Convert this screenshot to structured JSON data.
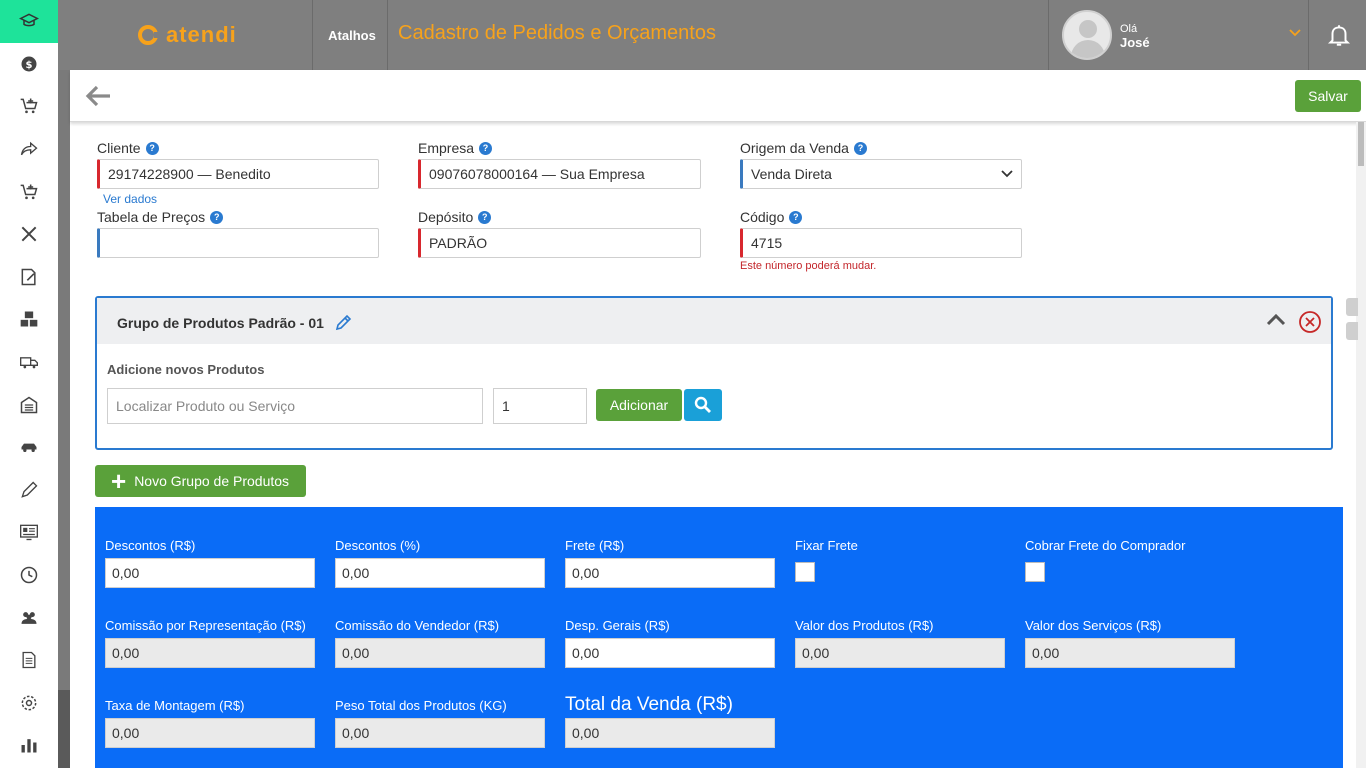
{
  "header": {
    "logo_text": "atendi",
    "shortcuts_label": "Atalhos",
    "page_title": "Cadastro de Pedidos e Orçamentos",
    "user_greeting": "Olá",
    "user_name": "José"
  },
  "toolbar": {
    "save_label": "Salvar"
  },
  "sidebar": {
    "icons": [
      "graduation-cap-icon",
      "dollar-icon",
      "cart-add-icon",
      "share-icon",
      "cart-icon",
      "tools-icon",
      "edit-note-icon",
      "boxes-icon",
      "truck-icon",
      "warehouse-icon",
      "car-icon",
      "pencil-icon",
      "id-card-icon",
      "clock-icon",
      "users-icon",
      "report-icon",
      "gear-icon",
      "bar-chart-icon"
    ],
    "active_color": "#1ee39a"
  },
  "form": {
    "cliente": {
      "label": "Cliente",
      "value": "29174228900 — Benedito",
      "link": "Ver dados"
    },
    "empresa": {
      "label": "Empresa",
      "value": "09076078000164 — Sua Empresa"
    },
    "origem": {
      "label": "Origem da Venda",
      "value": "Venda Direta"
    },
    "tabela": {
      "label": "Tabela de Preços",
      "value": ""
    },
    "deposito": {
      "label": "Depósito",
      "value": "PADRÃO"
    },
    "codigo": {
      "label": "Código",
      "value": "4715",
      "warning": "Este número poderá mudar."
    }
  },
  "group": {
    "title": "Grupo de Produtos Padrão - 01",
    "subtitle": "Adicione novos Produtos",
    "search_placeholder": "Localizar Produto ou Serviço",
    "quantity": "1",
    "add_label": "Adicionar"
  },
  "new_group_label": "Novo Grupo de Produtos",
  "totals": {
    "descontos_rs": {
      "label": "Descontos (R$)",
      "value": "0,00"
    },
    "descontos_pct": {
      "label": "Descontos (%)",
      "value": "0,00"
    },
    "frete": {
      "label": "Frete (R$)",
      "value": "0,00"
    },
    "fixar_frete": {
      "label": "Fixar Frete"
    },
    "cobrar_frete": {
      "label": "Cobrar Frete do Comprador"
    },
    "comissao_rep": {
      "label": "Comissão por Representação (R$)",
      "value": "0,00"
    },
    "comissao_vend": {
      "label": "Comissão do Vendedor (R$)",
      "value": "0,00"
    },
    "desp_gerais": {
      "label": "Desp. Gerais (R$)",
      "value": "0,00"
    },
    "valor_produtos": {
      "label": "Valor dos Produtos (R$)",
      "value": "0,00"
    },
    "valor_servicos": {
      "label": "Valor dos Serviços (R$)",
      "value": "0,00"
    },
    "taxa_montagem": {
      "label": "Taxa de Montagem (R$)",
      "value": "0,00"
    },
    "peso_total": {
      "label": "Peso Total dos Produtos (KG)",
      "value": "0,00"
    },
    "total_venda": {
      "label": "Total da Venda (R$)",
      "value": "0,00"
    }
  },
  "colors": {
    "accent_orange": "#f7a21b",
    "header_gray": "#7f7f7f",
    "panel_blue": "#0a6cf7",
    "button_green": "#5aa13a",
    "search_blue": "#1aa0d8"
  }
}
